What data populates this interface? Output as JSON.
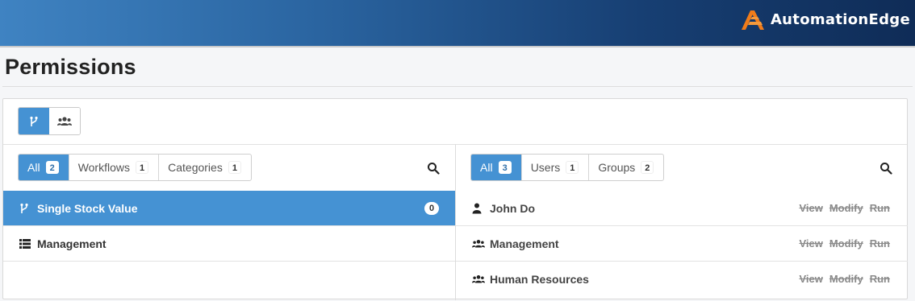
{
  "brand": {
    "name": "AutomationEdge",
    "accent": "#f07c1a"
  },
  "page": {
    "title": "Permissions"
  },
  "view_toggle": [
    {
      "icon": "workflow-icon",
      "active": true
    },
    {
      "icon": "users-icon",
      "active": false
    }
  ],
  "left": {
    "filters": [
      {
        "label": "All",
        "count": "2",
        "active": true
      },
      {
        "label": "Workflows",
        "count": "1",
        "active": false
      },
      {
        "label": "Categories",
        "count": "1",
        "active": false
      }
    ],
    "items": [
      {
        "icon": "workflow-icon",
        "label": "Single Stock Value",
        "count": "0",
        "selected": true
      },
      {
        "icon": "list-icon",
        "label": "Management",
        "selected": false
      }
    ]
  },
  "right": {
    "filters": [
      {
        "label": "All",
        "count": "3",
        "active": true
      },
      {
        "label": "Users",
        "count": "1",
        "active": false
      },
      {
        "label": "Groups",
        "count": "2",
        "active": false
      }
    ],
    "items": [
      {
        "icon": "user-icon",
        "label": "John Do",
        "perms": [
          "View",
          "Modify",
          "Run"
        ]
      },
      {
        "icon": "group-icon",
        "label": "Management",
        "perms": [
          "View",
          "Modify",
          "Run"
        ]
      },
      {
        "icon": "group-icon",
        "label": "Human Resources",
        "perms": [
          "View",
          "Modify",
          "Run"
        ]
      }
    ]
  },
  "colors": {
    "primary": "#4592d3",
    "header_dark": "#0f2c57",
    "header_light": "#3f83c2"
  }
}
